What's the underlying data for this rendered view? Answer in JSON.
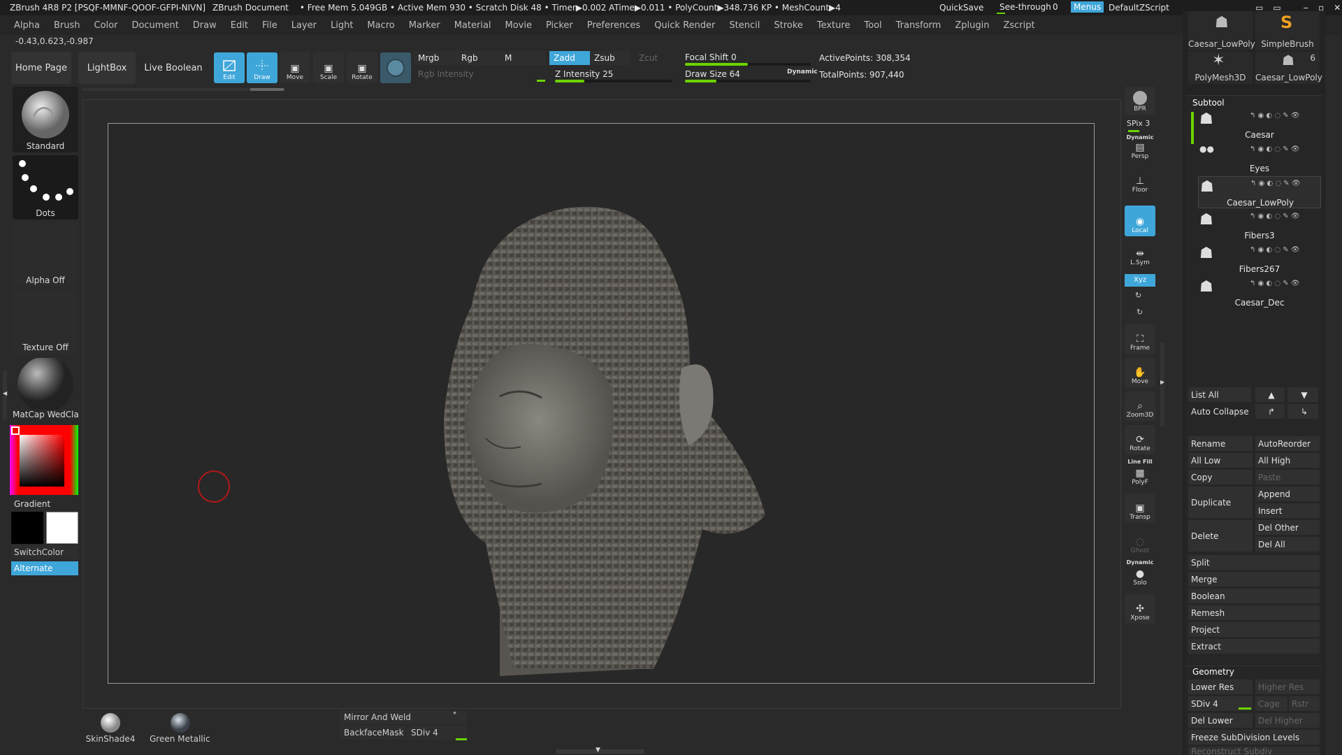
{
  "titlebar": {
    "app": "ZBrush 4R8 P2 [PSQF-MMNF-QOOF-GFPI-NIVN]",
    "document": "ZBrush Document",
    "stats": "• Free Mem 5.049GB • Active Mem 930 • Scratch Disk 48 • Timer▶0.002 ATime▶0.011 • PolyCount▶348.736 KP • MeshCount▶4",
    "quicksave": "QuickSave",
    "seethrough_label": "See-through",
    "seethrough_value": "0",
    "menus": "Menus",
    "script": "DefaultZScript"
  },
  "menubar": [
    "Alpha",
    "Brush",
    "Color",
    "Document",
    "Draw",
    "Edit",
    "File",
    "Layer",
    "Light",
    "Macro",
    "Marker",
    "Material",
    "Movie",
    "Picker",
    "Preferences",
    "Quick Render",
    "Stencil",
    "Stroke",
    "Texture",
    "Tool",
    "Transform",
    "Zplugin",
    "Zscript"
  ],
  "coords": "-0.43,0.623,-0.987",
  "toolbar": {
    "home": "Home Page",
    "lightbox": "LightBox",
    "liveboolean": "Live Boolean",
    "edit": "Edit",
    "draw": "Draw",
    "move": "Move",
    "scale": "Scale",
    "rotate": "Rotate",
    "mrgb": "Mrgb",
    "rgb": "Rgb",
    "m": "M",
    "zadd": "Zadd",
    "zsub": "Zsub",
    "zcut": "Zcut",
    "rgb_intensity": "Rgb Intensity",
    "z_intensity": "Z Intensity 25",
    "focal_shift": "Focal Shift 0",
    "draw_size": "Draw Size 64",
    "dynamic": "Dynamic",
    "active_points": "ActivePoints: 308,354",
    "total_points": "TotalPoints: 907,440",
    "z_intensity_level": 0.25,
    "draw_size_level": 0.25,
    "focal_shift_level": 0.5
  },
  "leftpanel": {
    "brush": "Standard",
    "stroke": "Dots",
    "alpha": "Alpha Off",
    "texture": "Texture Off",
    "material": "MatCap WedClay",
    "gradient": "Gradient",
    "switchcolor": "SwitchColor",
    "alternate": "Alternate"
  },
  "rightbar": {
    "bpr": "BPR",
    "spix": "SPix 3",
    "dynamic": "Dynamic",
    "persp": "Persp",
    "floor": "Floor",
    "local": "Local",
    "lsym": "L.Sym",
    "xyz": "Xyz",
    "frame": "Frame",
    "move": "Move",
    "zoom3d": "Zoom3D",
    "rotate": "Rotate",
    "linefill": "Line Fill",
    "polyf": "PolyF",
    "transp": "Transp",
    "ghost": "Ghost",
    "dynamic2": "Dynamic",
    "solo": "Solo",
    "xpose": "Xpose"
  },
  "rightpanel": {
    "thumbs": [
      "Caesar_LowPoly",
      "SimpleBrush",
      "PolyMesh3D",
      "Caesar_LowPoly"
    ],
    "thumb_count": "6",
    "subtool_title": "Subtool",
    "subtools": [
      "Caesar",
      "Eyes",
      "Caesar_LowPoly",
      "Fibers3",
      "Fibers267",
      "Caesar_Dec"
    ],
    "listall": "List All",
    "autocollapse": "Auto Collapse",
    "rename": "Rename",
    "autoreorder": "AutoReorder",
    "alllow": "All Low",
    "allhigh": "All High",
    "copy": "Copy",
    "paste": "Paste",
    "duplicate": "Duplicate",
    "append": "Append",
    "insert": "Insert",
    "delete": "Delete",
    "delother": "Del Other",
    "delall": "Del All",
    "split": "Split",
    "merge": "Merge",
    "boolean": "Boolean",
    "remesh": "Remesh",
    "project": "Project",
    "extract": "Extract",
    "geometry": "Geometry",
    "lowerres": "Lower Res",
    "higherres": "Higher Res",
    "sdiv": "SDiv 4",
    "cage": "Cage",
    "rstr": "Rstr",
    "dellower": "Del Lower",
    "delhigher": "Del Higher",
    "freeze": "Freeze SubDivision Levels",
    "reconstruct": "Reconstruct Subdiv"
  },
  "bottombar": {
    "mat1": "SkinShade4",
    "mat2": "Green Metallic",
    "mirror": "Mirror And Weld",
    "backface": "BackfaceMask",
    "sdiv": "SDiv 4"
  },
  "colors": {
    "accent": "#3fa6d9",
    "slider": "#6bd400"
  }
}
